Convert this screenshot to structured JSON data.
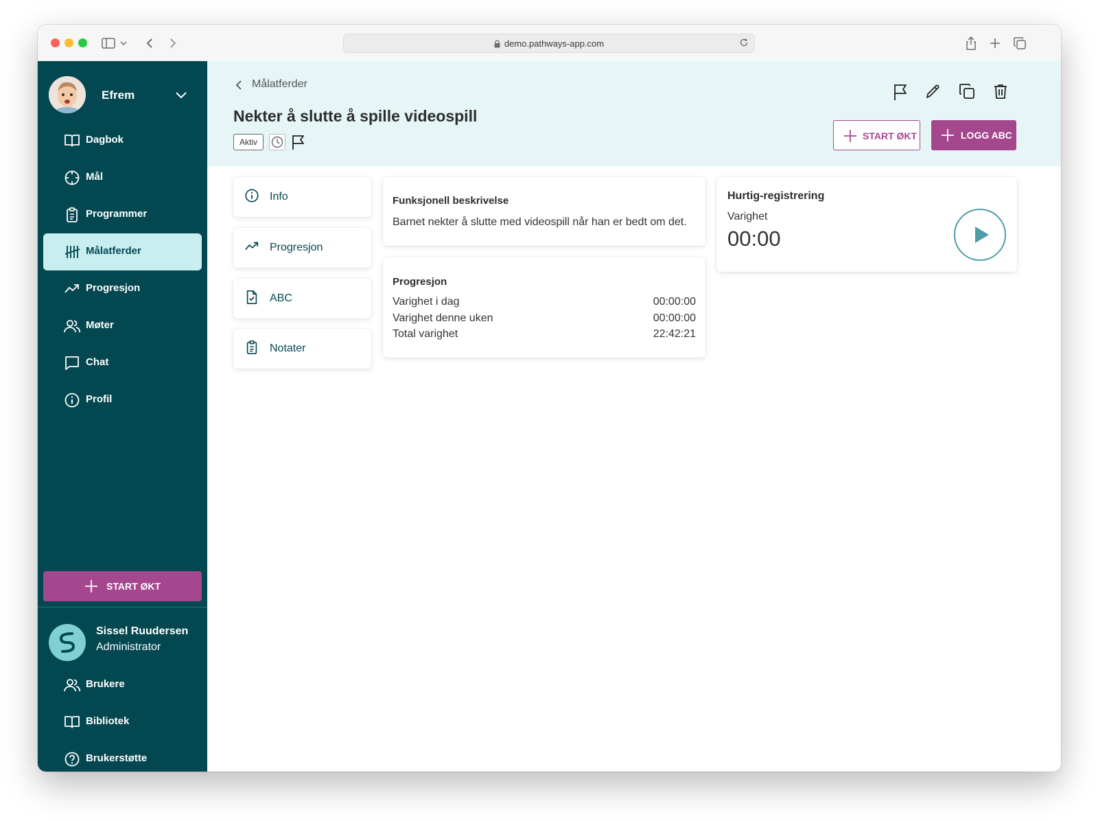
{
  "browser": {
    "url": "demo.pathways-app.com"
  },
  "sidebar": {
    "profile_name": "Efrem",
    "items": [
      {
        "label": "Dagbok",
        "icon": "book-icon"
      },
      {
        "label": "Mål",
        "icon": "target-icon"
      },
      {
        "label": "Programmer",
        "icon": "clipboard-icon"
      },
      {
        "label": "Målatferder",
        "icon": "tally-icon",
        "active": true
      },
      {
        "label": "Progresjon",
        "icon": "trend-up-icon"
      },
      {
        "label": "Møter",
        "icon": "users-icon"
      },
      {
        "label": "Chat",
        "icon": "chat-icon"
      },
      {
        "label": "Profil",
        "icon": "info-icon"
      }
    ],
    "start_button": "START ØKT",
    "admin": {
      "name": "Sissel Ruudersen",
      "role": "Administrator"
    },
    "bottom_items": [
      {
        "label": "Brukere",
        "icon": "users-icon"
      },
      {
        "label": "Bibliotek",
        "icon": "book-icon"
      },
      {
        "label": "Brukerstøtte",
        "icon": "help-icon"
      }
    ]
  },
  "header": {
    "breadcrumb": "Målatferder",
    "title": "Nekter å slutte å spille videospill",
    "status_badge": "Aktiv",
    "start_button": "START ØKT",
    "log_button": "LOGG ABC"
  },
  "tabs": [
    {
      "label": "Info",
      "icon": "info-icon"
    },
    {
      "label": "Progresjon",
      "icon": "trend-up-icon"
    },
    {
      "label": "ABC",
      "icon": "file-check-icon"
    },
    {
      "label": "Notater",
      "icon": "clipboard-icon"
    }
  ],
  "description": {
    "title": "Funksjonell beskrivelse",
    "text": "Barnet nekter å slutte med videospill når han er bedt om det."
  },
  "progress": {
    "title": "Progresjon",
    "rows": [
      {
        "label": "Varighet i dag",
        "value": "00:00:00"
      },
      {
        "label": "Varighet denne uken",
        "value": "00:00:00"
      },
      {
        "label": "Total varighet",
        "value": "22:42:21"
      }
    ]
  },
  "quick": {
    "title": "Hurtig-registrering",
    "label": "Varighet",
    "timer": "00:00"
  },
  "colors": {
    "sidebar": "#034851",
    "accent": "#a5478f",
    "header_bg": "#e6f5f6",
    "active_item": "#c8eef0"
  }
}
